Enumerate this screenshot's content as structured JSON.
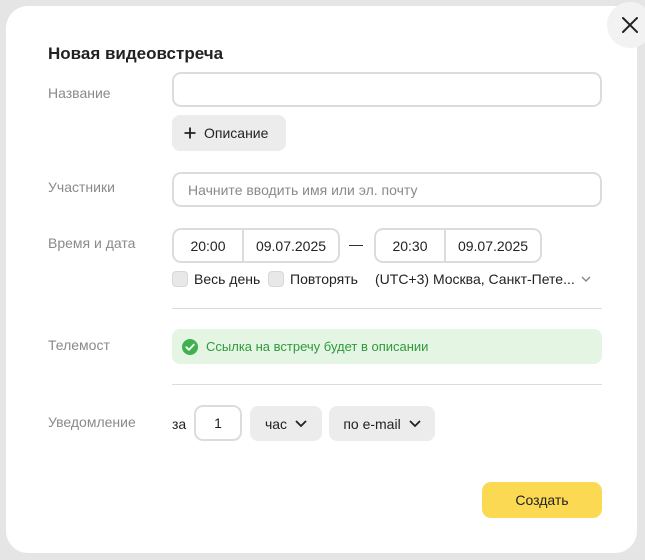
{
  "dialog": {
    "title": "Новая видеовстреча",
    "close_icon": "close-icon"
  },
  "fields": {
    "name_label": "Название",
    "name_value": "",
    "description_button": "Описание",
    "participants_label": "Участники",
    "participants_placeholder": "Начните вводить имя или эл. почту",
    "datetime_label": "Время и дата",
    "start_time": "20:00",
    "start_date": "09.07.2025",
    "range_separator": "—",
    "end_time": "20:30",
    "end_date": "09.07.2025",
    "all_day_label": "Весь день",
    "all_day_checked": false,
    "repeat_label": "Повторять",
    "repeat_checked": false,
    "timezone": "(UTC+3) Москва, Санкт-Пете...",
    "telemost_label": "Телемост",
    "telemost_info": "Ссылка на встречу будет в описании",
    "notification_label": "Уведомление",
    "notification_prefix": "за",
    "notification_amount": "1",
    "notification_unit": "час",
    "notification_channel": "по e-mail"
  },
  "actions": {
    "create_label": "Создать"
  },
  "colors": {
    "accent": "#fcd952",
    "success": "#2f9a3c",
    "success_bg": "#e4f5e4"
  }
}
